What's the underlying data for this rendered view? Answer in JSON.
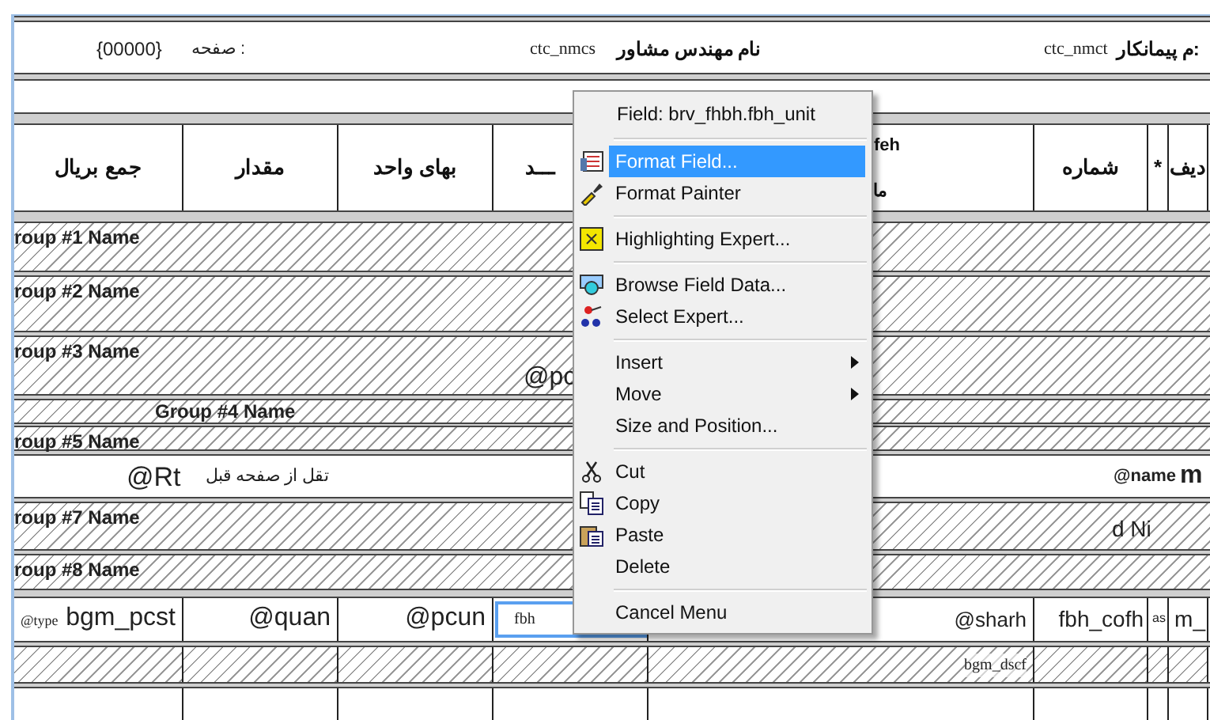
{
  "page_header": {
    "page_value": "{00000}",
    "page_label": "صفحه :",
    "consultant_value": "ctc_nmcs",
    "consultant_label": "نام مهندس مشاور",
    "contractor_value": "ctc_nmct",
    "contractor_label": "م پیمانکار:"
  },
  "column_headers": [
    {
      "text": "دیف"
    },
    {
      "text": "*"
    },
    {
      "text": "شماره"
    },
    {
      "text": "feh",
      "text_2": "ما"
    },
    {
      "text": "ـــد"
    },
    {
      "text": "بهای واحد"
    },
    {
      "text": "مقدار"
    },
    {
      "text": "جمع بریال"
    }
  ],
  "group_bands": [
    {
      "label": "roup #1 Name",
      "kind": "group"
    },
    {
      "label": "roup #2 Name",
      "kind": "group"
    },
    {
      "label": "roup #3 Name",
      "kind": "group",
      "field": "@pc"
    },
    {
      "label": "Group #4 Name",
      "kind": "inner"
    },
    {
      "label": "roup #5 Name",
      "kind": "group"
    },
    {
      "kind": "carry",
      "field": "@Rt",
      "label": "تقل از صفحه قبل",
      "field_2": "@name",
      "field_3": "m"
    },
    {
      "label": "roup #7 Name",
      "kind": "group",
      "field": "d Ni"
    },
    {
      "label": "roup #8 Name",
      "kind": "group"
    }
  ],
  "detail_fields": [
    {
      "prefix": "@type",
      "text": "bgm_pcst",
      "selected": false
    },
    {
      "text": "@quan",
      "selected": false
    },
    {
      "text": "@pcun",
      "selected": false
    },
    {
      "text": "fbh",
      "selected": true
    },
    {
      "text": "@sharh",
      "selected": false
    },
    {
      "text": "fbh_cofh",
      "selected": false
    },
    {
      "text": "as",
      "selected": false
    },
    {
      "text": "m_",
      "selected": false
    }
  ],
  "detail_sub_field": "bgm_dscf",
  "context_menu": {
    "title": "Field: brv_fhbh.fbh_unit",
    "items": [
      {
        "kind": "separator"
      },
      {
        "kind": "item",
        "label": "Format Field...",
        "selected": true,
        "submenu": false
      },
      {
        "kind": "item",
        "label": "Format Painter",
        "selected": false,
        "submenu": false
      },
      {
        "kind": "separator"
      },
      {
        "kind": "item",
        "label": "Highlighting Expert...",
        "selected": false,
        "submenu": false
      },
      {
        "kind": "separator"
      },
      {
        "kind": "item",
        "label": "Browse Field Data...",
        "selected": false,
        "submenu": false
      },
      {
        "kind": "item",
        "label": "Select Expert...",
        "selected": false,
        "submenu": false
      },
      {
        "kind": "separator"
      },
      {
        "kind": "item",
        "label": "Insert",
        "selected": false,
        "submenu": true
      },
      {
        "kind": "item",
        "label": "Move",
        "selected": false,
        "submenu": true
      },
      {
        "kind": "item",
        "label": "Size and Position...",
        "selected": false,
        "submenu": false
      },
      {
        "kind": "separator"
      },
      {
        "kind": "item",
        "label": "Cut",
        "selected": false,
        "submenu": false
      },
      {
        "kind": "item",
        "label": "Copy",
        "selected": false,
        "submenu": false
      },
      {
        "kind": "item",
        "label": "Paste",
        "selected": false,
        "submenu": false
      },
      {
        "kind": "item",
        "label": "Delete",
        "selected": false,
        "submenu": false
      },
      {
        "kind": "separator"
      },
      {
        "kind": "item",
        "label": "Cancel Menu",
        "selected": false,
        "submenu": false
      }
    ]
  }
}
